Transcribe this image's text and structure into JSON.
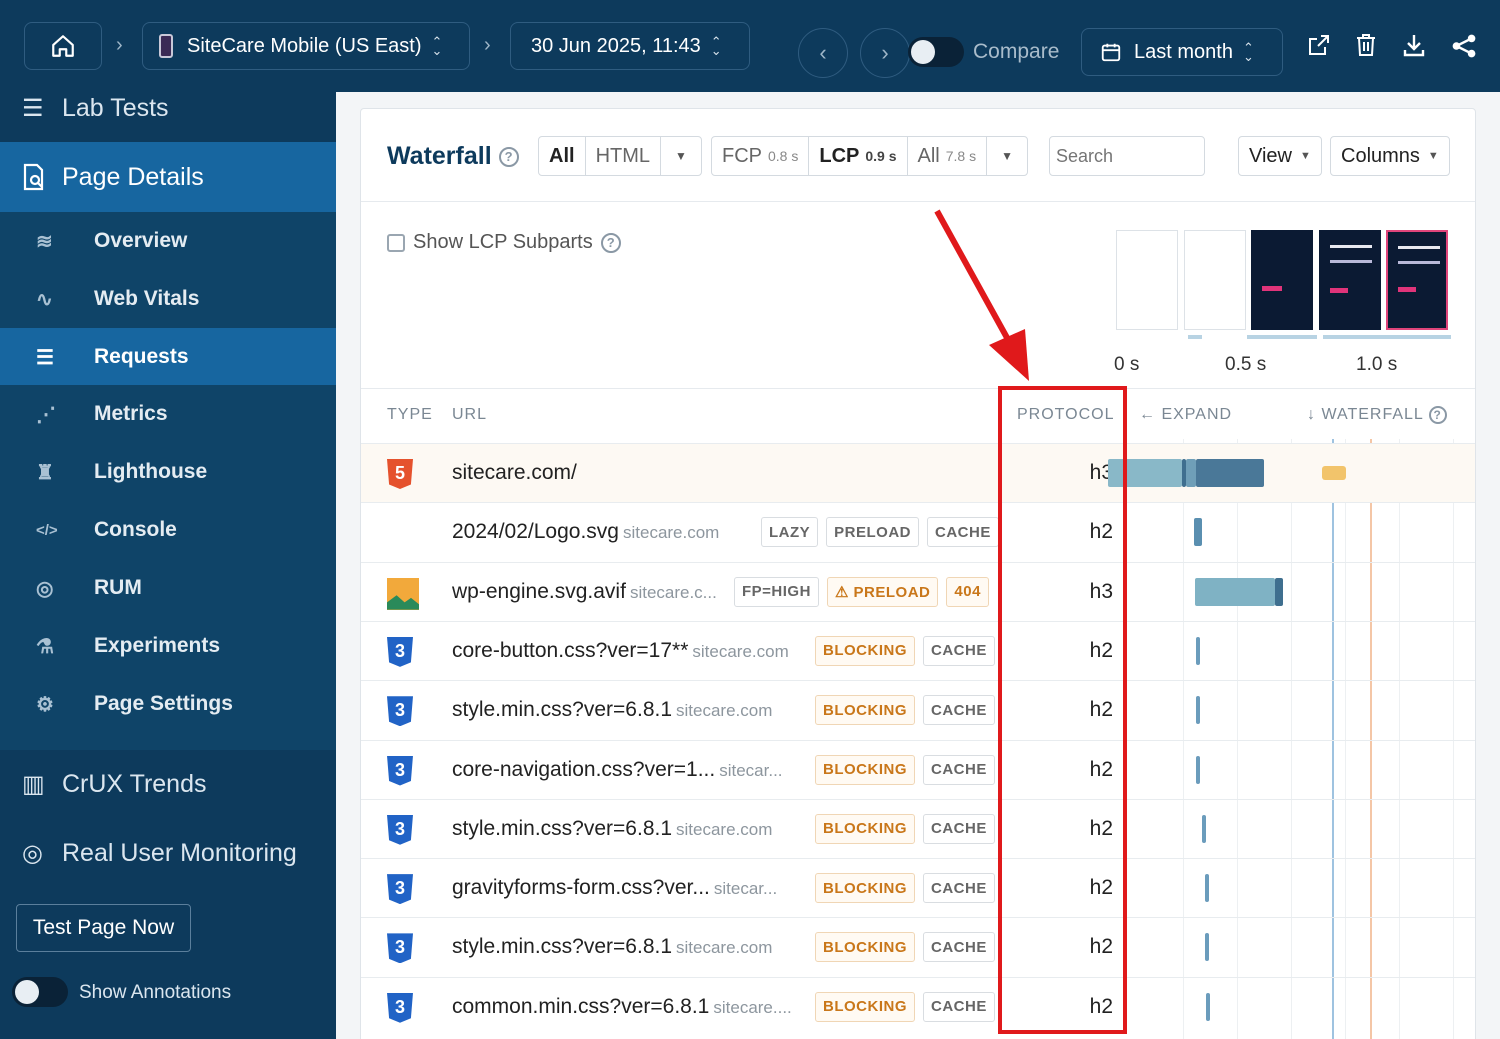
{
  "topbar": {
    "site_label": "SiteCare Mobile (US East)",
    "date_label": "30 Jun 2025, 11:43",
    "compare_label": "Compare",
    "range_label": "Last month",
    "icons": [
      "home-icon",
      "phone-icon",
      "chevron-left-icon",
      "chevron-right-icon",
      "calendar-icon",
      "external-link-icon",
      "trash-icon",
      "download-icon",
      "share-icon"
    ]
  },
  "sidebar": {
    "lab_tests": "Lab Tests",
    "page_details": "Page Details",
    "items": [
      {
        "label": "Overview",
        "icon": "layers-icon"
      },
      {
        "label": "Web Vitals",
        "icon": "pulse-icon"
      },
      {
        "label": "Requests",
        "icon": "list-icon",
        "active": true
      },
      {
        "label": "Metrics",
        "icon": "graph-icon"
      },
      {
        "label": "Lighthouse",
        "icon": "lighthouse-icon"
      },
      {
        "label": "Console",
        "icon": "code-icon"
      },
      {
        "label": "RUM",
        "icon": "rum-icon"
      },
      {
        "label": "Experiments",
        "icon": "flask-icon"
      },
      {
        "label": "Page Settings",
        "icon": "gear-icon"
      }
    ],
    "crux": "CrUX Trends",
    "rum": "Real User Monitoring",
    "test_button": "Test Page Now",
    "annotations": "Show Annotations"
  },
  "toolbar": {
    "title": "Waterfall",
    "filter_all": "All",
    "filter_html": "HTML",
    "fcp_label": "FCP",
    "fcp_value": "0.8 s",
    "lcp_label": "LCP",
    "lcp_value": "0.9 s",
    "all_label": "All",
    "all_value": "7.8 s",
    "search_placeholder": "Search",
    "view_label": "View",
    "columns_label": "Columns"
  },
  "lcp_subparts_label": "Show LCP Subparts",
  "timeline_ticks": [
    "0 s",
    "0.5 s",
    "1.0 s"
  ],
  "columns": {
    "type": "TYPE",
    "url": "URL",
    "protocol": "PROTOCOL",
    "expand": "← EXPAND",
    "waterfall": "↓ WATERFALL"
  },
  "rows": [
    {
      "type": "html",
      "url": "sitecare.com/",
      "host": "",
      "tags": [],
      "protocol": "h3"
    },
    {
      "type": "none",
      "url": "2024/02/Logo.svg",
      "host": "sitecare.com",
      "tags": [
        "LAZY",
        "PRELOAD",
        "CACHE"
      ],
      "protocol": "h2"
    },
    {
      "type": "image",
      "url": "wp-engine.svg.avif",
      "host": "sitecare.c...",
      "tags": [
        "FP=HIGH",
        "⚠ PRELOAD",
        "404"
      ],
      "protocol": "h3"
    },
    {
      "type": "css",
      "url": "core-button.css?ver=17**",
      "host": "sitecare.com",
      "tags": [
        "BLOCKING",
        "CACHE"
      ],
      "protocol": "h2"
    },
    {
      "type": "css",
      "url": "style.min.css?ver=6.8.1",
      "host": "sitecare.com",
      "tags": [
        "BLOCKING",
        "CACHE"
      ],
      "protocol": "h2"
    },
    {
      "type": "css",
      "url": "core-navigation.css?ver=1...",
      "host": "sitecar...",
      "tags": [
        "BLOCKING",
        "CACHE"
      ],
      "protocol": "h2"
    },
    {
      "type": "css",
      "url": "style.min.css?ver=6.8.1",
      "host": "sitecare.com",
      "tags": [
        "BLOCKING",
        "CACHE"
      ],
      "protocol": "h2"
    },
    {
      "type": "css",
      "url": "gravityforms-form.css?ver...",
      "host": "sitecar...",
      "tags": [
        "BLOCKING",
        "CACHE"
      ],
      "protocol": "h2"
    },
    {
      "type": "css",
      "url": "style.min.css?ver=6.8.1",
      "host": "sitecare.com",
      "tags": [
        "BLOCKING",
        "CACHE"
      ],
      "protocol": "h2"
    },
    {
      "type": "css",
      "url": "common.min.css?ver=6.8.1",
      "host": "sitecare....",
      "tags": [
        "BLOCKING",
        "CACHE"
      ],
      "protocol": "h2"
    }
  ],
  "colors": {
    "bar": "#7fb2c4",
    "bar_dark": "#3f6f8f",
    "warn": "#c9771a",
    "highlight": "#e0191b",
    "lcp_marker": "#f2c46b"
  }
}
